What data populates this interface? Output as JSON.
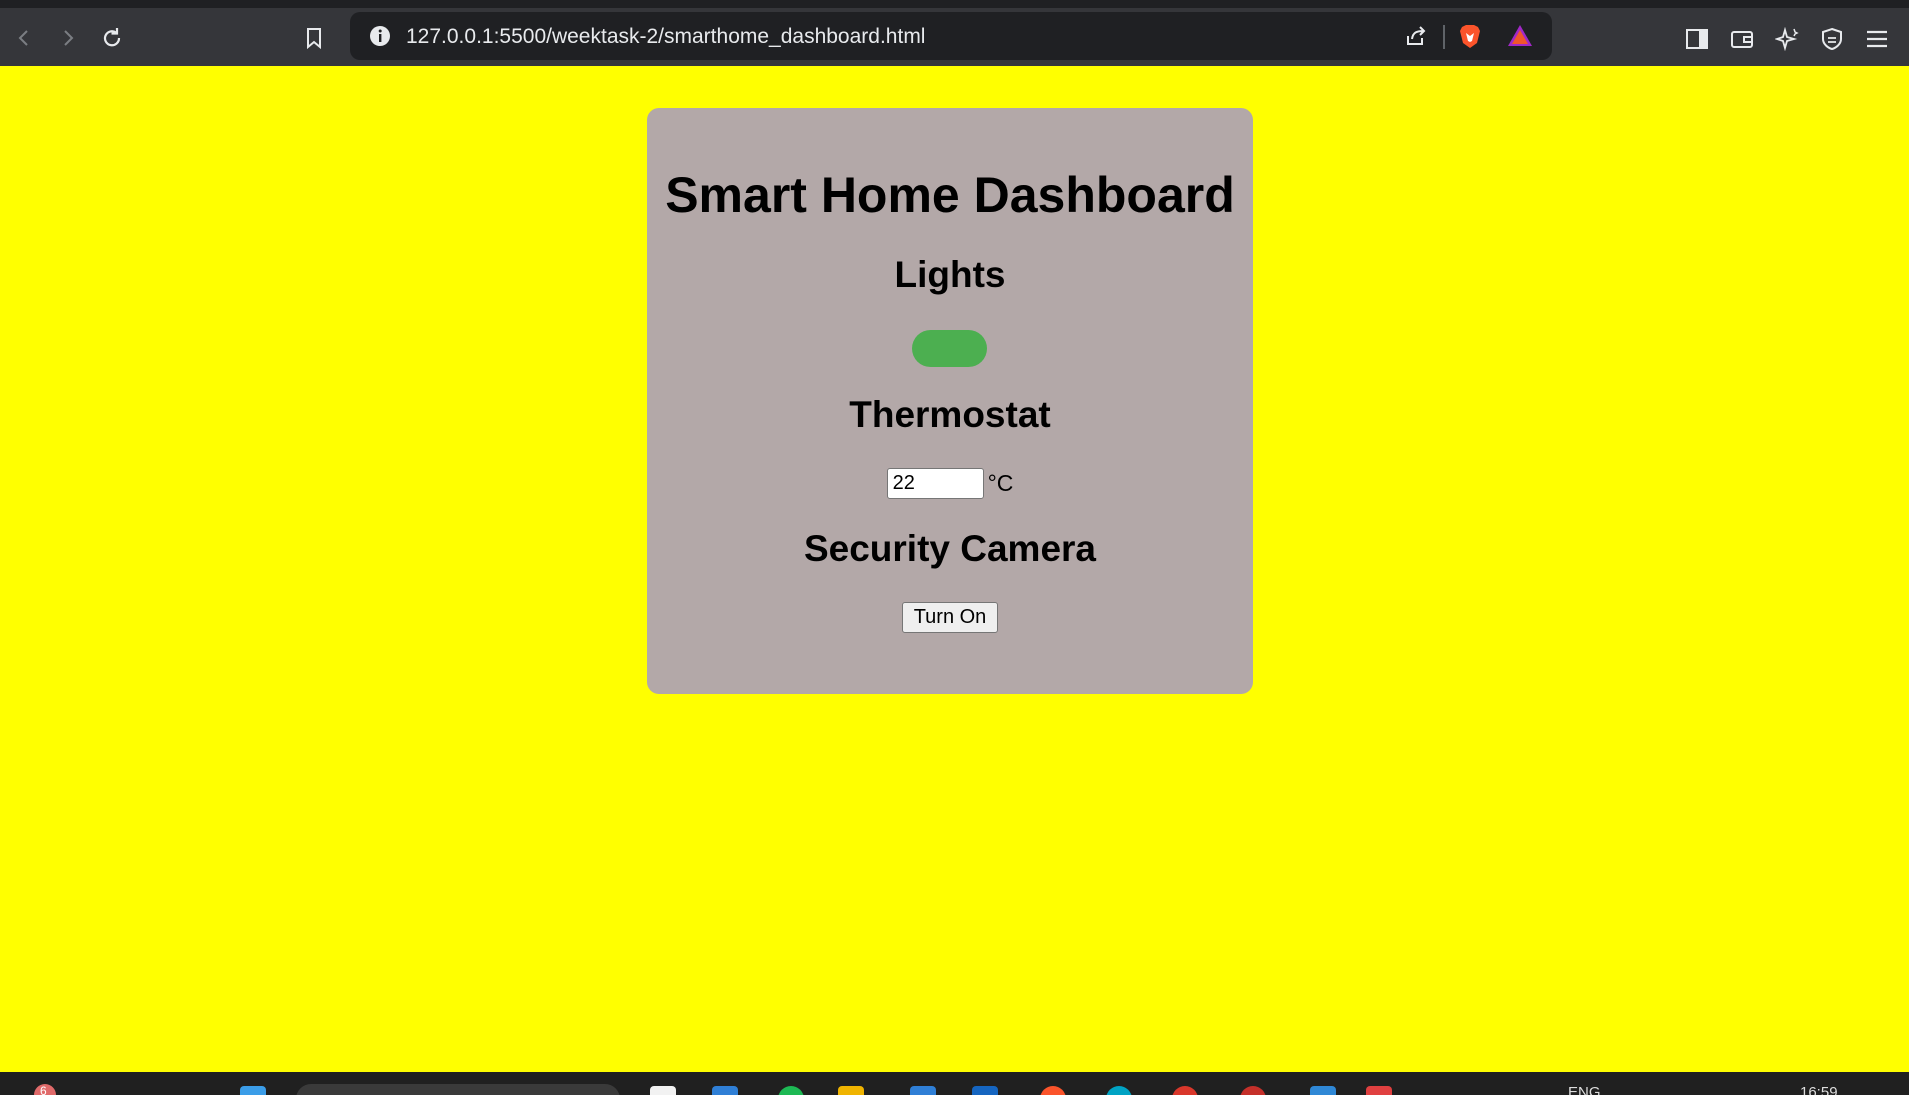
{
  "browser": {
    "url": "127.0.0.1:5500/weektask-2/smarthome_dashboard.html"
  },
  "dashboard": {
    "title": "Smart Home Dashboard",
    "lights": {
      "heading": "Lights",
      "toggle_state": "on",
      "toggle_color": "#4caf50"
    },
    "thermostat": {
      "heading": "Thermostat",
      "value": "22",
      "unit": "°C"
    },
    "camera": {
      "heading": "Security Camera",
      "button_label": "Turn On"
    },
    "colors": {
      "page_background": "#ffff00",
      "card_background": "#b3a8a8"
    }
  },
  "taskbar": {
    "language": "ENG",
    "time": "16:59",
    "notification_count": "6"
  }
}
